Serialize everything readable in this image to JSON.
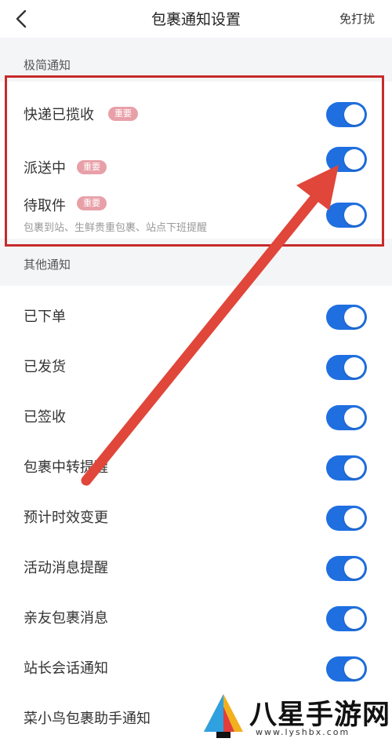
{
  "header": {
    "title": "包裹通知设置",
    "dnd_label": "免打扰"
  },
  "sections": {
    "simple": {
      "title": "极简通知",
      "items": [
        {
          "label": "快递已揽收",
          "badge": "重要",
          "enabled": true
        },
        {
          "label": "派送中",
          "badge": "重要",
          "enabled": true
        },
        {
          "label": "待取件",
          "badge": "重要",
          "sub": "包裹到站、生鲜贵重包裹、站点下班提醒",
          "enabled": true
        }
      ]
    },
    "other": {
      "title": "其他通知",
      "items": [
        {
          "label": "已下单",
          "enabled": true
        },
        {
          "label": "已发货",
          "enabled": true
        },
        {
          "label": "已签收",
          "enabled": true
        },
        {
          "label": "包裹中转提醒",
          "enabled": true
        },
        {
          "label": "预计时效变更",
          "enabled": true
        },
        {
          "label": "活动消息提醒",
          "enabled": true
        },
        {
          "label": "亲友包裹消息",
          "enabled": true
        },
        {
          "label": "站长会话通知",
          "enabled": true
        },
        {
          "label": "菜小鸟包裹助手通知",
          "enabled": true
        }
      ]
    }
  },
  "watermark": {
    "text": "八星手游网",
    "url": "www.lyshbx.com"
  },
  "colors": {
    "toggle_on": "#1f6fe0",
    "badge": "#e8a0a8",
    "highlight": "#c62b2b",
    "arrow": "#e0463a"
  }
}
